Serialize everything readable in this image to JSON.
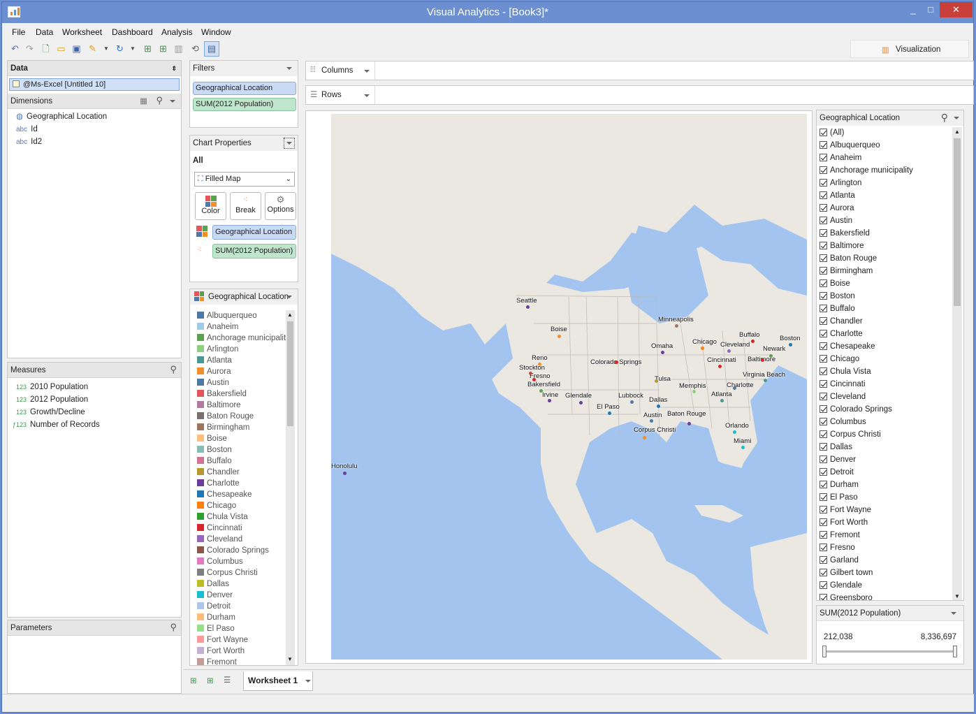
{
  "window": {
    "title": "Visual Analytics - [Book3]*",
    "minimize": "_",
    "maximize": "□",
    "close": "✕"
  },
  "menu": [
    "File",
    "Data",
    "Worksheet",
    "Dashboard",
    "Analysis",
    "Window"
  ],
  "visualization_button": "Visualization",
  "data_panel": {
    "header": "Data",
    "source": "@Ms-Excel [Untitled 10]",
    "dimensions_header": "Dimensions",
    "dimensions": [
      {
        "type": "globe",
        "name": "Geographical Location"
      },
      {
        "type": "abc",
        "name": "Id"
      },
      {
        "type": "abc",
        "name": "Id2"
      }
    ],
    "measures_header": "Measures",
    "measures": [
      {
        "type": "123",
        "name": "2010 Population"
      },
      {
        "type": "123",
        "name": "2012 Population"
      },
      {
        "type": "123",
        "name": "Growth/Decline"
      },
      {
        "type": "f123",
        "name": "Number of Records"
      }
    ],
    "parameters_header": "Parameters"
  },
  "filters": {
    "header": "Filters",
    "pills": [
      "Geographical Location",
      "SUM(2012 Population)"
    ]
  },
  "chart_properties": {
    "header": "Chart Properties",
    "scope": "All",
    "chart_type": "Filled Map",
    "buttons": [
      "Color",
      "Break",
      "Options"
    ],
    "color_pill": "Geographical Location",
    "break_pill": "SUM(2012 Population)"
  },
  "columns_label": "Columns",
  "rows_label": "Rows",
  "legend": {
    "header": "Geographical Location",
    "items": [
      {
        "name": "Albuquerqueo",
        "color": "#4e79a7"
      },
      {
        "name": "Anaheim",
        "color": "#a0cbe8"
      },
      {
        "name": "Anchorage municipality",
        "color": "#59a14f"
      },
      {
        "name": "Arlington",
        "color": "#8cd17d"
      },
      {
        "name": "Atlanta",
        "color": "#499894"
      },
      {
        "name": "Aurora",
        "color": "#f28e2b"
      },
      {
        "name": "Austin",
        "color": "#4e79a7"
      },
      {
        "name": "Bakersfield",
        "color": "#e15759"
      },
      {
        "name": "Baltimore",
        "color": "#b07aa1"
      },
      {
        "name": "Baton Rouge",
        "color": "#79706e"
      },
      {
        "name": "Birmingham",
        "color": "#9d7660"
      },
      {
        "name": "Boise",
        "color": "#ffbe7d"
      },
      {
        "name": "Boston",
        "color": "#86bcb6"
      },
      {
        "name": "Buffalo",
        "color": "#d37295"
      },
      {
        "name": "Chandler",
        "color": "#b6992d"
      },
      {
        "name": "Charlotte",
        "color": "#6a3d9a"
      },
      {
        "name": "Chesapeake",
        "color": "#1f77b4"
      },
      {
        "name": "Chicago",
        "color": "#ff7f0e"
      },
      {
        "name": "Chula Vista",
        "color": "#2ca02c"
      },
      {
        "name": "Cincinnati",
        "color": "#d62728"
      },
      {
        "name": "Cleveland",
        "color": "#9467bd"
      },
      {
        "name": "Colorado Springs",
        "color": "#8c564b"
      },
      {
        "name": "Columbus",
        "color": "#e377c2"
      },
      {
        "name": "Corpus Christi",
        "color": "#7f7f7f"
      },
      {
        "name": "Dallas",
        "color": "#bcbd22"
      },
      {
        "name": "Denver",
        "color": "#17becf"
      },
      {
        "name": "Detroit",
        "color": "#aec7e8"
      },
      {
        "name": "Durham",
        "color": "#ffbb78"
      },
      {
        "name": "El Paso",
        "color": "#98df8a"
      },
      {
        "name": "Fort Wayne",
        "color": "#ff9896"
      },
      {
        "name": "Fort Worth",
        "color": "#c5b0d5"
      },
      {
        "name": "Fremont",
        "color": "#c49c94"
      }
    ]
  },
  "filter_list": {
    "header": "Geographical Location",
    "items": [
      "(All)",
      "Albuquerqueo",
      "Anaheim",
      "Anchorage municipality",
      "Arlington",
      "Atlanta",
      "Aurora",
      "Austin",
      "Bakersfield",
      "Baltimore",
      "Baton Rouge",
      "Birmingham",
      "Boise",
      "Boston",
      "Buffalo",
      "Chandler",
      "Charlotte",
      "Chesapeake",
      "Chicago",
      "Chula Vista",
      "Cincinnati",
      "Cleveland",
      "Colorado Springs",
      "Columbus",
      "Corpus Christi",
      "Dallas",
      "Denver",
      "Detroit",
      "Durham",
      "El Paso",
      "Fort Wayne",
      "Fort Worth",
      "Fremont",
      "Fresno",
      "Garland",
      "Gilbert town",
      "Glendale",
      "Greensboro"
    ]
  },
  "range_filter": {
    "header": "SUM(2012 Population)",
    "min": "212,038",
    "max": "8,336,697"
  },
  "worksheet_tab": "Worksheet 1",
  "map_labels": {
    "Seattle": "Seattle",
    "Boise": "Boise",
    "Reno": "Reno",
    "Stockton": "Stockton",
    "Fresno": "Fresno",
    "Bakersfield": "Bakersfield",
    "Irvine": "Irvine",
    "Glendale": "Glendale",
    "El Paso": "El Paso",
    "Lubbock": "Lubbock",
    "Colorado Springs": "Colorado Springs",
    "Omaha": "Omaha",
    "Minneapolis": "Minneapolis",
    "Chicago": "Chicago",
    "Cleveland": "Cleveland",
    "Buffalo": "Buffalo",
    "Boston": "Boston",
    "Newark": "Newark",
    "Baltimore": "Baltimore",
    "Cincinnati": "Cincinnati",
    "Virginia Beach": "Virginia Beach",
    "Charlotte": "Charlotte",
    "Atlanta": "Atlanta",
    "Memphis": "Memphis",
    "Tulsa": "Tulsa",
    "Dallas": "Dallas",
    "Austin": "Austin",
    "Baton Rouge": "Baton Rouge",
    "Corpus Christi": "Corpus Christi",
    "Orlando": "Orlando",
    "Miami": "Miami",
    "Honolulu": "Honolulu"
  }
}
